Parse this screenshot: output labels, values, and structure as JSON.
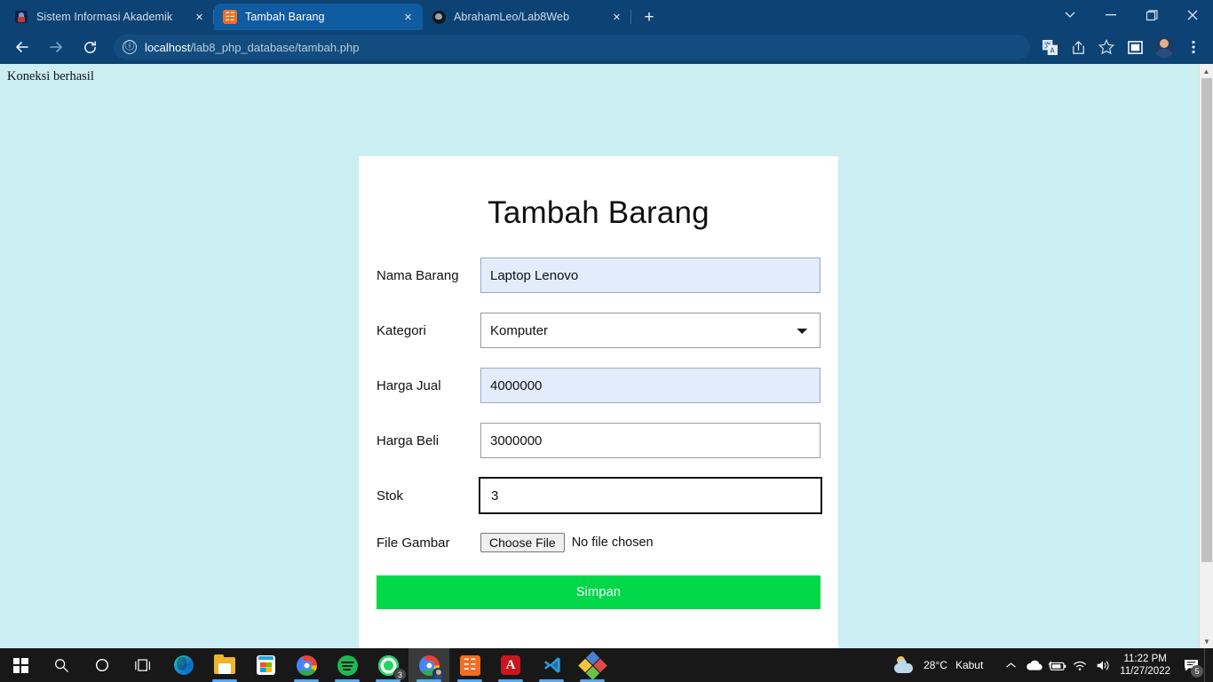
{
  "browser": {
    "tabs": [
      {
        "title": "Sistem Informasi Akademik",
        "favicon": "sia-icon",
        "active": false
      },
      {
        "title": "Tambah Barang",
        "favicon": "xampp-icon",
        "active": true
      },
      {
        "title": "AbrahamLeo/Lab8Web",
        "favicon": "github-icon",
        "active": false
      }
    ],
    "new_tab_label": "+",
    "tab_close_label": "✕",
    "window_controls": {
      "tab_search": "⌄",
      "minimize": "—",
      "maximize": "❐",
      "close": "✕"
    },
    "toolbar": {
      "back": "←",
      "forward": "→",
      "reload": "⟳",
      "url_host": "localhost",
      "url_path": "/lab8_php_database/tambah.php",
      "site_info": "ⓘ"
    }
  },
  "page": {
    "connection_message": "Koneksi berhasil",
    "background_color": "#cbeef3",
    "card": {
      "title": "Tambah Barang",
      "fields": [
        {
          "label": "Nama Barang",
          "value": "Laptop Lenovo",
          "type": "text",
          "state": "autofill"
        },
        {
          "label": "Kategori",
          "value": "Komputer",
          "type": "select",
          "state": "normal"
        },
        {
          "label": "Harga Jual",
          "value": "4000000",
          "type": "text",
          "state": "autofill"
        },
        {
          "label": "Harga Beli",
          "value": "3000000",
          "type": "text",
          "state": "normal"
        },
        {
          "label": "Stok",
          "value": "3",
          "type": "text",
          "state": "focused"
        }
      ],
      "file_field": {
        "label": "File Gambar",
        "button": "Choose File",
        "status": "No file chosen"
      },
      "submit_label": "Simpan",
      "submit_color": "#00d84a"
    }
  },
  "taskbar": {
    "items": [
      {
        "name": "start",
        "label": "Start"
      },
      {
        "name": "search",
        "label": "Search"
      },
      {
        "name": "cortana",
        "label": "Cortana"
      },
      {
        "name": "task-view",
        "label": "Task View"
      },
      {
        "name": "edge",
        "label": "Microsoft Edge"
      },
      {
        "name": "file-explorer",
        "label": "File Explorer"
      },
      {
        "name": "microsoft-store",
        "label": "Microsoft Store"
      },
      {
        "name": "chrome",
        "label": "Google Chrome"
      },
      {
        "name": "spotify",
        "label": "Spotify"
      },
      {
        "name": "whatsapp",
        "label": "WhatsApp",
        "badge": "3"
      },
      {
        "name": "chrome-active",
        "label": "Google Chrome"
      },
      {
        "name": "xampp",
        "label": "XAMPP Control Panel"
      },
      {
        "name": "acrobat",
        "label": "Adobe Acrobat"
      },
      {
        "name": "vscode",
        "label": "Visual Studio Code"
      },
      {
        "name": "mysql-workbench",
        "label": "MySQL Workbench"
      }
    ],
    "tray": {
      "weather_temp": "28°C",
      "weather_condition": "Kabut",
      "show_hidden": "∧",
      "onedrive": "☁",
      "battery": "battery-icon",
      "network": "wifi-icon",
      "volume": "volume-icon",
      "time": "11:22 PM",
      "date": "11/27/2022",
      "notification_count": "5"
    }
  }
}
